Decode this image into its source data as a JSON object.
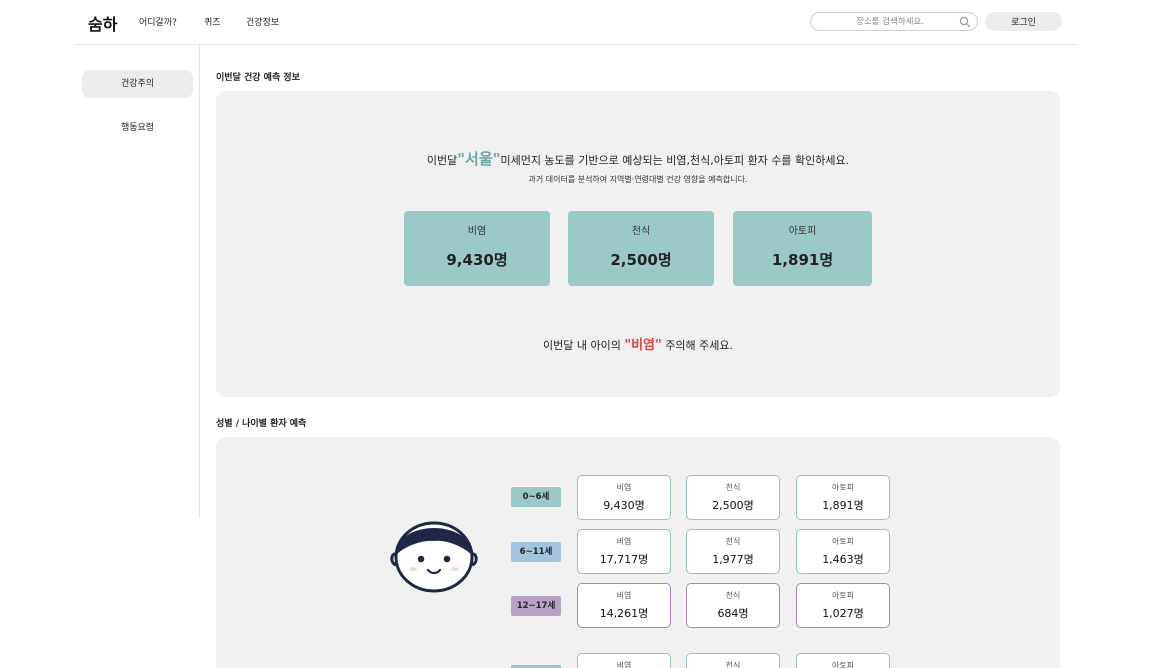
{
  "header": {
    "logo": "숨하",
    "nav": [
      "어디갈까?",
      "퀴즈",
      "건강정보"
    ],
    "search_placeholder": "장소를 검색하세요.",
    "login_label": "로그인"
  },
  "sidebar": {
    "items": [
      {
        "label": "건강주의",
        "active": true
      },
      {
        "label": "행동요령",
        "active": false
      }
    ]
  },
  "forecast": {
    "section_title": "이번달 건강 예측 정보",
    "intro_prefix": "이번달",
    "city": "\"서울\"",
    "intro_suffix": "미세먼지 농도를 기반으로 예상되는 비염,천식,아토피 환자 수를 확인하세요.",
    "subtext": "과거 데이터를 분석하여 지역별·연령대별 건강 영향을 예측합니다.",
    "stats": [
      {
        "label": "비염",
        "value": "9,430명"
      },
      {
        "label": "천식",
        "value": "2,500명"
      },
      {
        "label": "아토피",
        "value": "1,891명"
      }
    ],
    "warning_prefix": "이번달 내 아이의",
    "warning_disease": "\"비염\"",
    "warning_suffix": "주의해 주세요."
  },
  "by_age": {
    "section_title": "성별 / 나이별 환자 예측",
    "groups": [
      {
        "age": "0~6세",
        "badge_color": "#9bc9c8",
        "border_color": "#8fc6c4",
        "cells": [
          {
            "label": "비염",
            "value": "9,430명"
          },
          {
            "label": "천식",
            "value": "2,500명"
          },
          {
            "label": "아토피",
            "value": "1,891명"
          }
        ]
      },
      {
        "age": "6~11세",
        "badge_color": "#a3c4e0",
        "border_color": "#8fc6c4",
        "cells": [
          {
            "label": "비염",
            "value": "17,717명"
          },
          {
            "label": "천식",
            "value": "1,977명"
          },
          {
            "label": "아토피",
            "value": "1,463명"
          }
        ]
      },
      {
        "age": "12~17세",
        "badge_color": "#b9a2c8",
        "border_color": "#a887b8",
        "cells": [
          {
            "label": "비염",
            "value": "14,261명"
          },
          {
            "label": "천식",
            "value": "684명"
          },
          {
            "label": "아토피",
            "value": "1,027명"
          }
        ]
      },
      {
        "age": "",
        "badge_color": "#9bc9c8",
        "border_color": "#8fc6c4",
        "cells": [
          {
            "label": "비염",
            "value": ""
          },
          {
            "label": "천식",
            "value": ""
          },
          {
            "label": "아토피",
            "value": ""
          }
        ]
      }
    ]
  },
  "colors": {
    "accent_teal": "#9bc9c8",
    "city_green": "#6aa6a3",
    "warning_red": "#e0443b",
    "face_navy": "#1f2747"
  }
}
